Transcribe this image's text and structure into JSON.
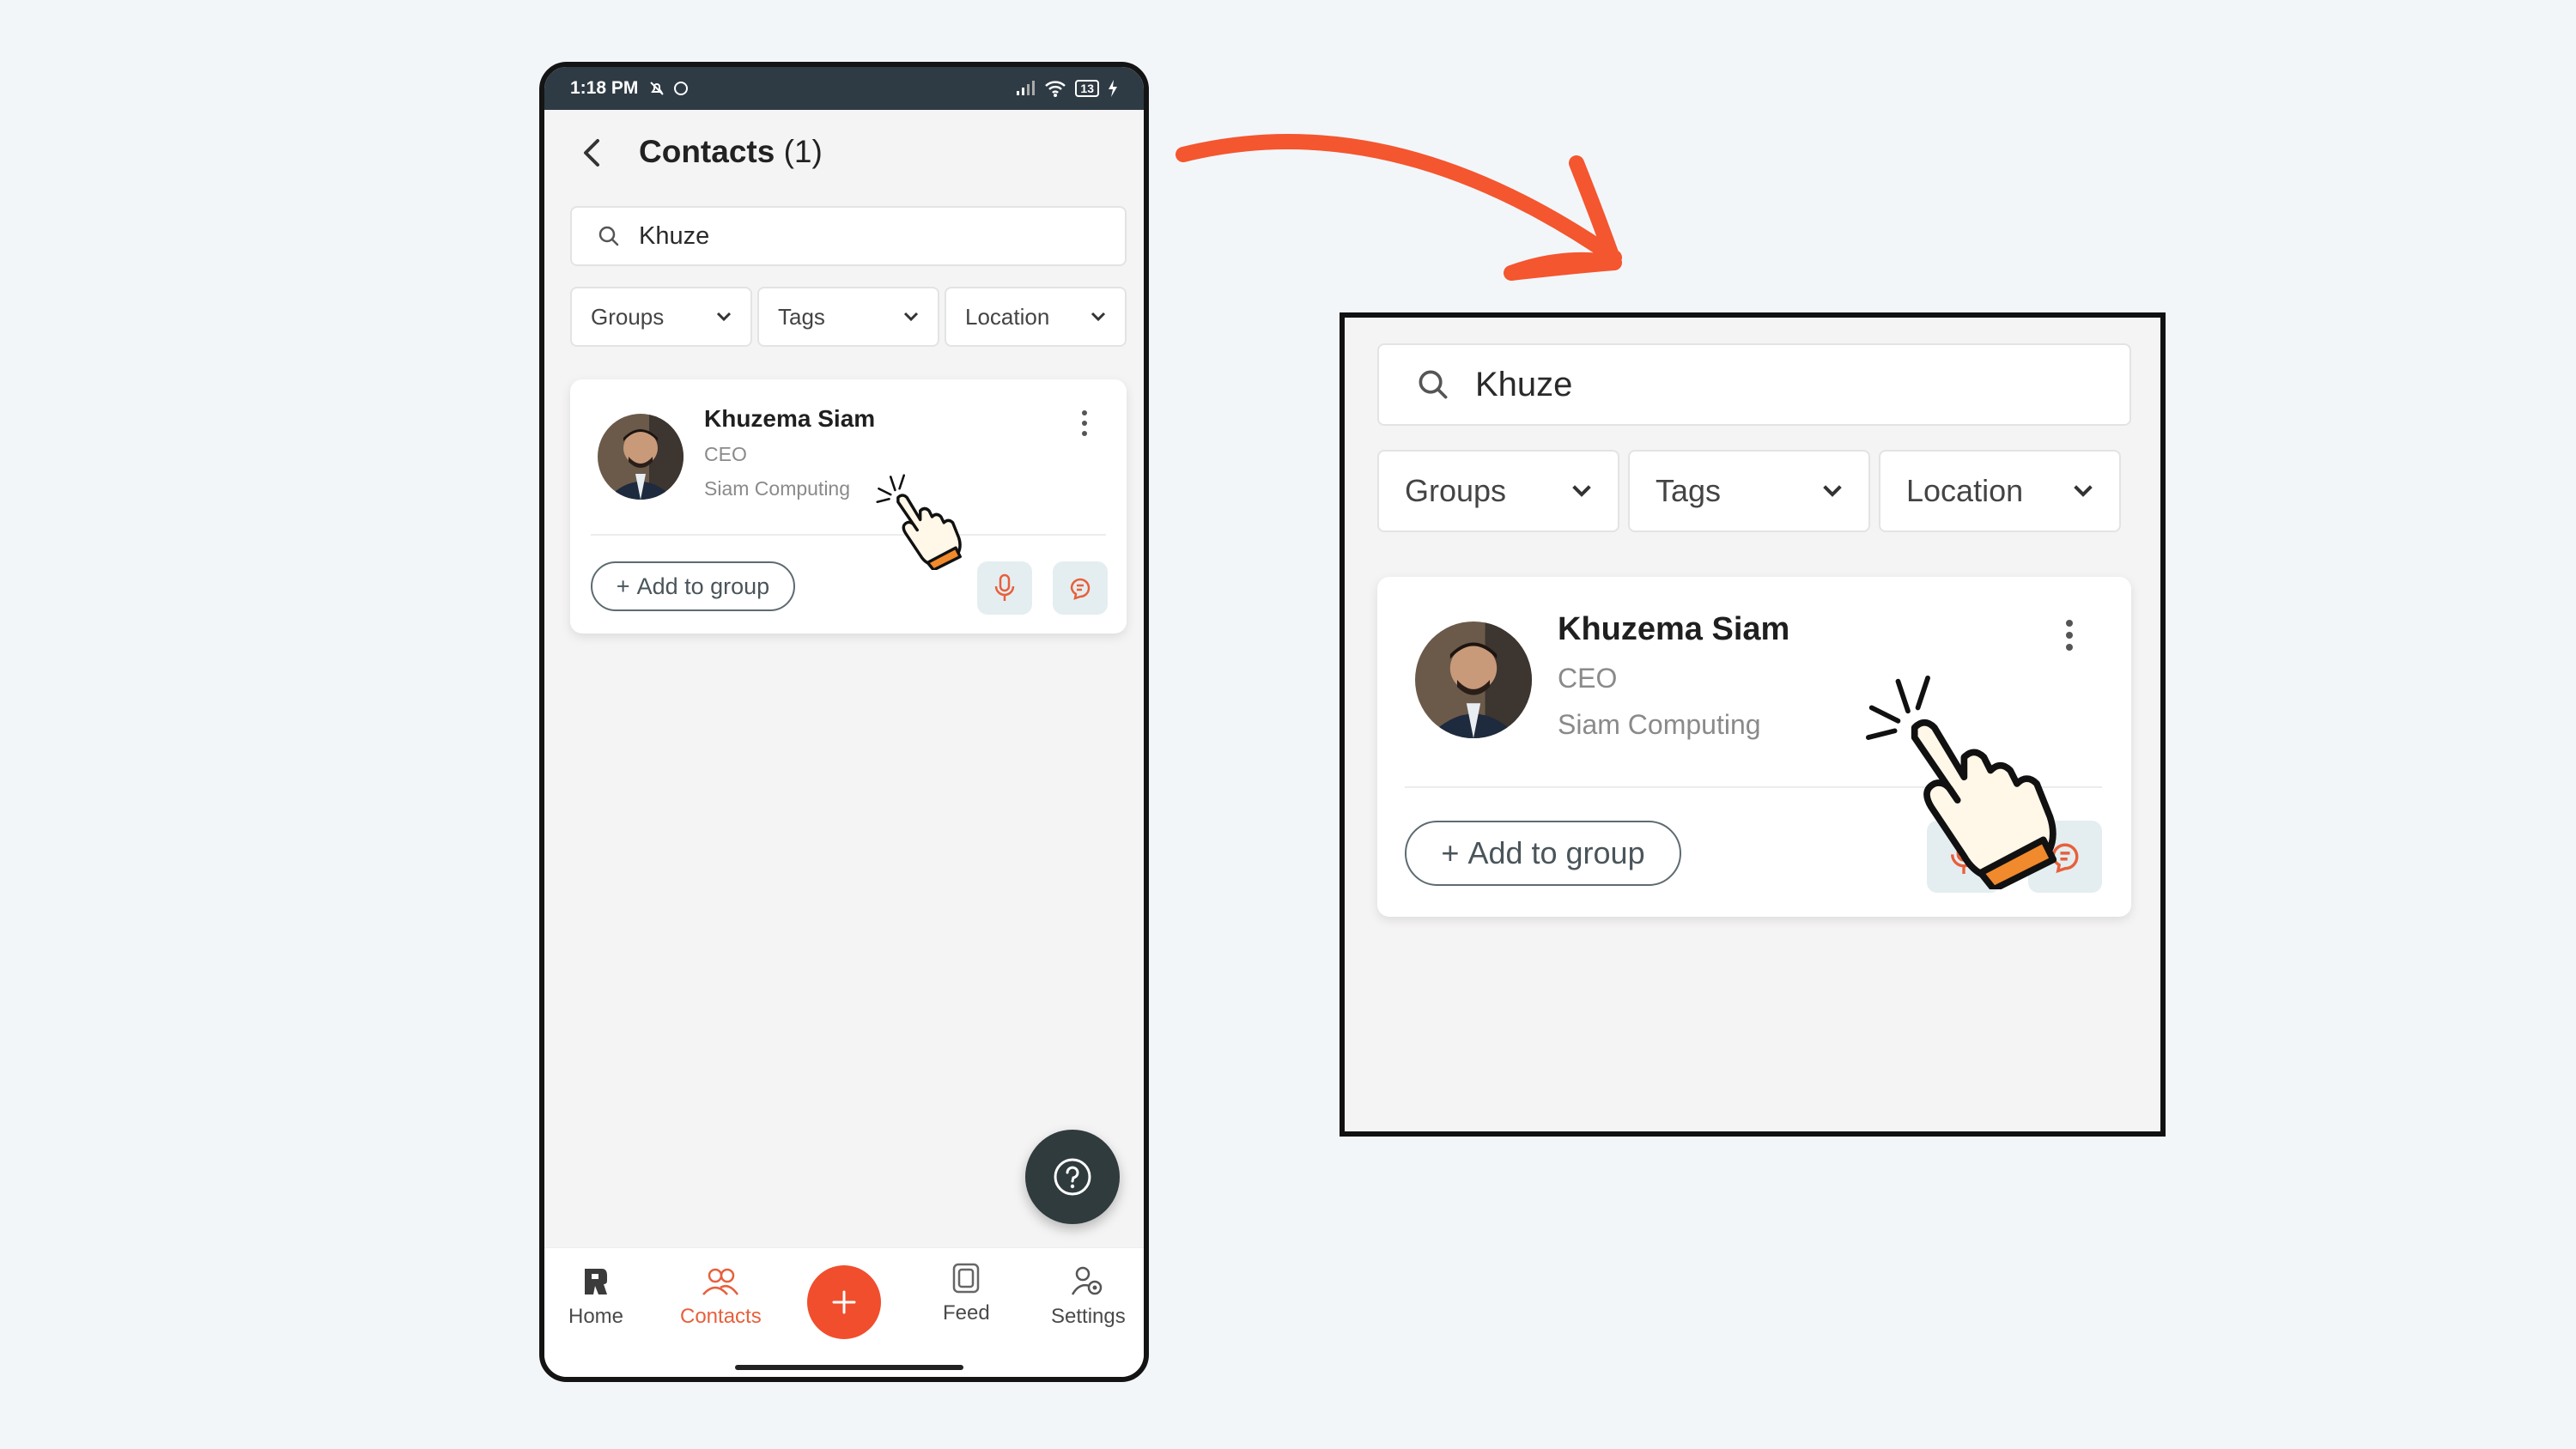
{
  "status_bar": {
    "time": "1:18 PM",
    "battery": "13"
  },
  "header": {
    "title": "Contacts",
    "count": "(1)"
  },
  "search": {
    "value": "Khuze"
  },
  "filters": [
    "Groups",
    "Tags",
    "Location"
  ],
  "contact": {
    "name": "Khuzema Siam",
    "role": "CEO",
    "company": "Siam Computing",
    "add_group_label": "Add to group"
  },
  "bottom_nav": {
    "home": "Home",
    "contacts": "Contacts",
    "feed": "Feed",
    "settings": "Settings"
  },
  "colors": {
    "accent": "#f04e2d",
    "arrow": "#f4562f",
    "status_bar": "#2f3b44",
    "help_fab": "#2f3b3d"
  },
  "icons": [
    "back-icon",
    "search-icon",
    "chevron-down-icon",
    "more-vert-icon",
    "mic-icon",
    "ai-brain-icon",
    "help-icon",
    "home-icon",
    "contacts-icon",
    "plus-icon",
    "feed-icon",
    "settings-icon",
    "pointer-hand-icon"
  ]
}
